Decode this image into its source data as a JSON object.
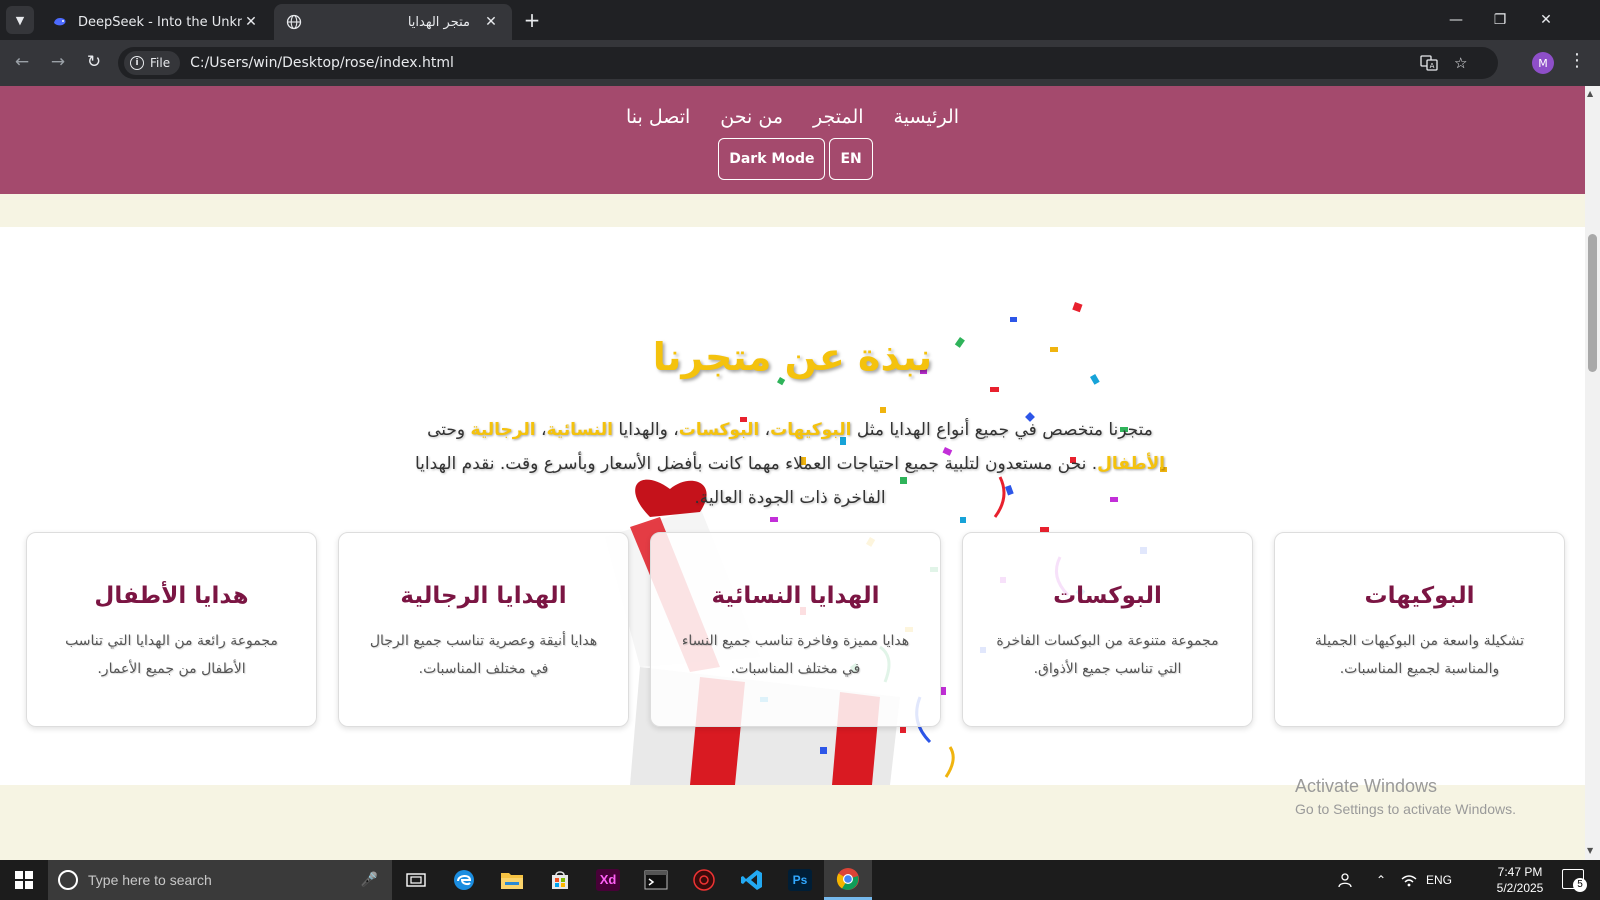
{
  "browser": {
    "tabs": [
      {
        "title": "DeepSeek - Into the Unknown",
        "icon": "deepseek-whale-icon",
        "active": false
      },
      {
        "title": "متجر الهدايا",
        "icon": "globe-icon",
        "active": true
      }
    ],
    "address": {
      "chip_label": "File",
      "url": "C:/Users/win/Desktop/rose/index.html"
    },
    "profile_initial": "M"
  },
  "site": {
    "nav": [
      {
        "label": "الرئيسية"
      },
      {
        "label": "المتجر"
      },
      {
        "label": "من نحن"
      },
      {
        "label": "اتصل بنا"
      }
    ],
    "buttons": {
      "dark_mode": "Dark Mode",
      "lang": "EN"
    },
    "about": {
      "title": "نبذة عن متجرنا",
      "text_1": "متجرنا متخصص في جميع أنواع الهدايا مثل ",
      "hl_1": "البوكيهات",
      "sep_1": "، ",
      "hl_2": "البوكسات",
      "text_2": "، والهدايا ",
      "hl_3": "النسائية",
      "sep_2": "، ",
      "hl_4": "الرجالية",
      "text_3": " وحتى ",
      "hl_5": "الأطفال",
      "text_4": ". نحن مستعدون لتلبية جميع احتياجات العملاء مهما كانت بأفضل الأسعار وبأسرع وقت. نقدم الهدايا الفاخرة ذات الجودة العالية."
    },
    "cards": [
      {
        "title": "البوكيهات",
        "desc": "تشكيلة واسعة من البوكيهات الجميلة والمناسبة لجميع المناسبات."
      },
      {
        "title": "البوكسات",
        "desc": "مجموعة متنوعة من البوكسات الفاخرة التي تناسب جميع الأذواق."
      },
      {
        "title": "الهدايا النسائية",
        "desc": "هدايا مميزة وفاخرة تناسب جميع النساء في مختلف المناسبات."
      },
      {
        "title": "الهدايا الرجالية",
        "desc": "هدايا أنيقة وعصرية تناسب جميع الرجال في مختلف المناسبات."
      },
      {
        "title": "هدايا الأطفال",
        "desc": "مجموعة رائعة من الهدايا التي تناسب الأطفال من جميع الأعمار."
      }
    ],
    "colors": {
      "header": "#a44a6d",
      "accent": "#f4c20d",
      "card_title": "#7b1543",
      "page_bg": "#f6f4e3"
    }
  },
  "watermark": {
    "line1": "Activate Windows",
    "line2": "Go to Settings to activate Windows."
  },
  "taskbar": {
    "search_placeholder": "Type here to search",
    "apps": [
      "task-view-icon",
      "edge-icon",
      "file-explorer-icon",
      "store-icon",
      "adobe-xd-icon",
      "terminal-icon",
      "davinci-icon",
      "vscode-icon",
      "photoshop-icon",
      "chrome-icon"
    ],
    "xd_label": "Xd",
    "ps_label": "Ps",
    "lang": "ENG",
    "time": "7:47 PM",
    "date": "5/2/2025",
    "notification_count": "5"
  }
}
